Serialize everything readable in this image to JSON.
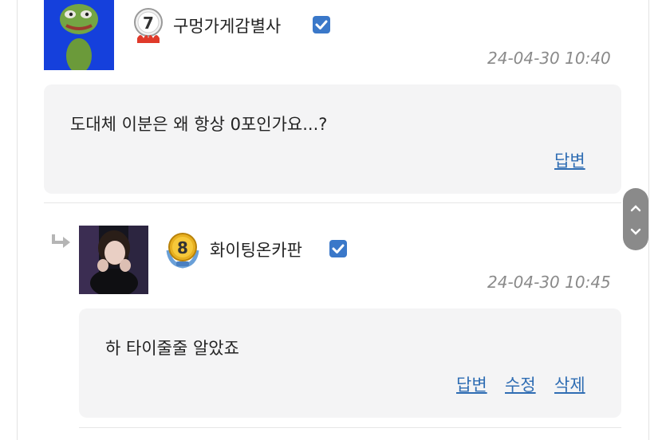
{
  "comments": [
    {
      "avatar": "pepe-frog-avatar",
      "level": "7",
      "nickname": "구멍가게감별사",
      "date": "24-04-30 10:40",
      "text": "도대체 이분은 왜 항상 0포인가요...?",
      "actions": [
        "답변"
      ]
    },
    {
      "avatar": "profile-photo-avatar",
      "level": "8",
      "nickname": "화이팅온카판",
      "date": "24-04-30 10:45",
      "text": "하 타이줄줄 알았죠",
      "actions": [
        "답변",
        "수정",
        "삭제"
      ]
    }
  ],
  "colors": {
    "accent_link": "#2f6db3",
    "verified": "#3a78c9",
    "bubble_bg": "#f4f4f5",
    "avatar1_bg": "#1540dc",
    "scroll_pill": "#8a8a8a"
  },
  "icons": {
    "verified": "checkmark-icon",
    "reply": "reply-arrow-icon",
    "scroll_up": "chevron-up-icon",
    "scroll_down": "chevron-down-icon"
  }
}
